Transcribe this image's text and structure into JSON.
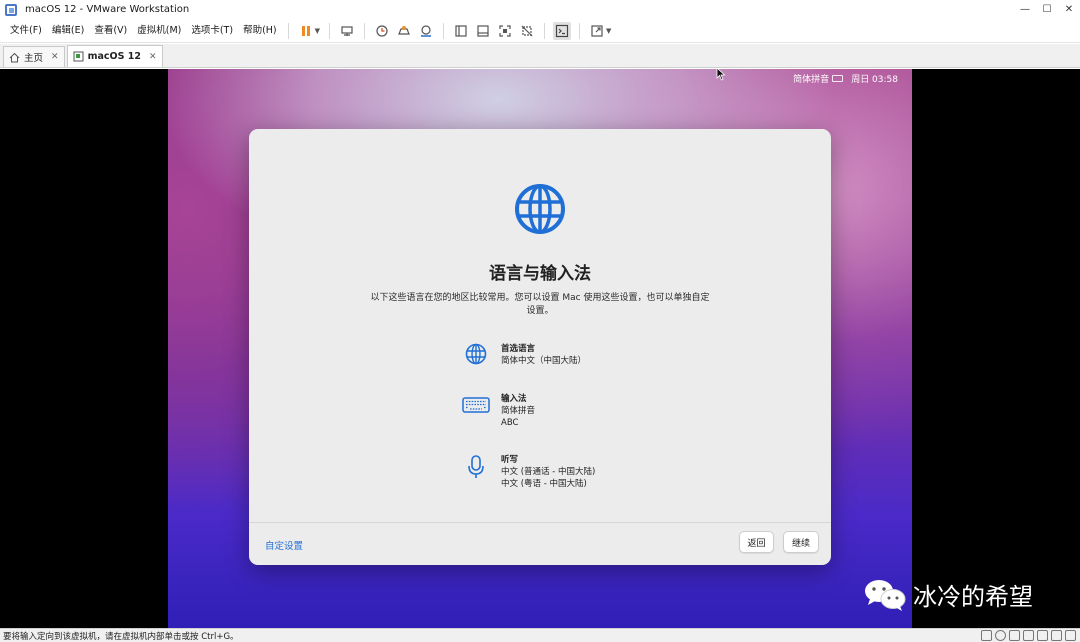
{
  "window": {
    "title": "macOS 12 - VMware Workstation",
    "minimize": "—",
    "maximize": "☐",
    "close": "✕"
  },
  "menu": [
    "文件(F)",
    "编辑(E)",
    "查看(V)",
    "虚拟机(M)",
    "选项卡(T)",
    "帮助(H)"
  ],
  "tabs": [
    {
      "label": "主页",
      "icon": "home-icon"
    },
    {
      "label": "macOS 12",
      "icon": "vm-icon",
      "active": true
    }
  ],
  "mac": {
    "input_method": "简体拼音",
    "clock": "周日 03:58"
  },
  "dialog": {
    "title": "语言与输入法",
    "description": "以下这些语言在您的地区比较常用。您可以设置 Mac 使用这些设置，也可以单独自定设置。",
    "rows": [
      {
        "icon": "globe-icon",
        "heading": "首选语言",
        "lines": [
          "简体中文（中国大陆）"
        ]
      },
      {
        "icon": "keyboard-icon",
        "heading": "输入法",
        "lines": [
          "简体拼音",
          "ABC"
        ]
      },
      {
        "icon": "microphone-icon",
        "heading": "听写",
        "lines": [
          "中文 (普通话 - 中国大陆)",
          "中文 (粤语 - 中国大陆)"
        ]
      }
    ],
    "custom_link": "自定设置",
    "back_button": "返回",
    "continue_button": "继续"
  },
  "watermark": "冰冷的希望",
  "status_text": "要将输入定向到该虚拟机，请在虚拟机内部单击或按 Ctrl+G。",
  "colors": {
    "accent": "#2670d8",
    "pause": "#f08a24"
  }
}
